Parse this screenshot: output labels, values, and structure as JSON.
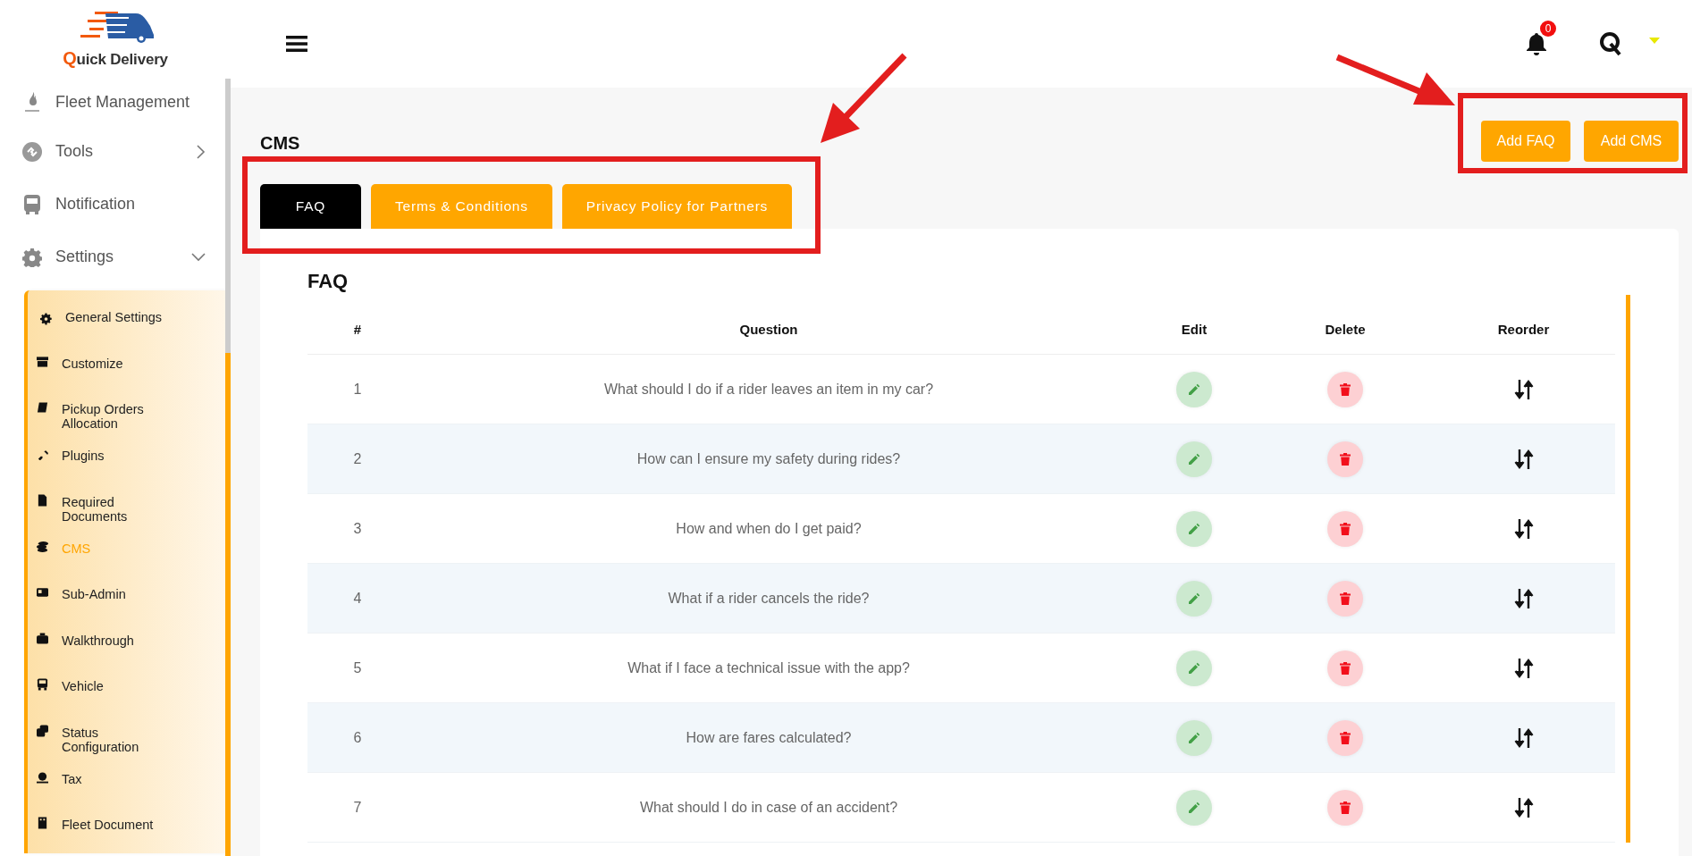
{
  "logo": {
    "name": "Quick Delivery"
  },
  "sidebar": {
    "items": [
      {
        "label": "Fleet Management",
        "kind": "link"
      },
      {
        "label": "Tools",
        "kind": "group",
        "expanded": false
      },
      {
        "label": "Notification",
        "kind": "link"
      },
      {
        "label": "Settings",
        "kind": "group",
        "expanded": true,
        "children": [
          {
            "label": "General Settings",
            "selected": false
          },
          {
            "label": "Customize",
            "selected": false
          },
          {
            "label": "Pickup Orders Allocation",
            "selected": false
          },
          {
            "label": "Plugins",
            "selected": false
          },
          {
            "label": "Required Documents",
            "selected": false
          },
          {
            "label": "CMS",
            "selected": true
          },
          {
            "label": "Sub-Admin",
            "selected": false
          },
          {
            "label": "Walkthrough",
            "selected": false
          },
          {
            "label": "Vehicle",
            "selected": false
          },
          {
            "label": "Status Configuration",
            "selected": false
          },
          {
            "label": "Tax",
            "selected": false
          },
          {
            "label": "Fleet Document",
            "selected": false
          }
        ]
      }
    ]
  },
  "header": {
    "notification_count": "0"
  },
  "page": {
    "title": "CMS",
    "actions": [
      "Add FAQ",
      "Add CMS"
    ],
    "tabs": [
      {
        "label": "FAQ",
        "selected": true
      },
      {
        "label": "Terms & Conditions",
        "selected": false
      },
      {
        "label": "Privacy Policy for Partners",
        "selected": false
      }
    ],
    "faq": {
      "heading": "FAQ",
      "columns": [
        "#",
        "Question",
        "Edit",
        "Delete",
        "Reorder"
      ],
      "rows": [
        {
          "number": "1",
          "question": "What should I do if a rider leaves an item in my car?"
        },
        {
          "number": "2",
          "question": "How can I ensure my safety during rides?"
        },
        {
          "number": "3",
          "question": "How and when do I get paid?"
        },
        {
          "number": "4",
          "question": "What if a rider cancels the ride?"
        },
        {
          "number": "5",
          "question": "What if I face a technical issue with the app?"
        },
        {
          "number": "6",
          "question": "How are fares calculated?"
        },
        {
          "number": "7",
          "question": "What should I do in case of an accident?"
        }
      ]
    }
  }
}
